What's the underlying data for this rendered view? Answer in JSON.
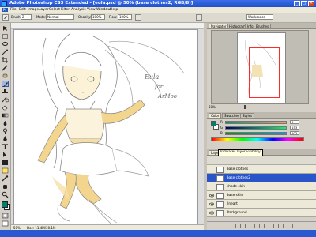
{
  "window": {
    "title": "Adobe Photoshop CS3 Extended - [eula.psd @ 50% (base clothes2, RGB/8)]"
  },
  "menu": [
    "File",
    "Edit",
    "Image",
    "Layer",
    "Select",
    "Filter",
    "Analysis",
    "View",
    "Window",
    "Help"
  ],
  "options": {
    "brush_label": "Brush:",
    "brush_size": "2",
    "mode_label": "Mode:",
    "mode_value": "Normal",
    "opacity_label": "Opacity:",
    "opacity_value": "100%",
    "flow_label": "Flow:",
    "flow_value": "100%",
    "workspace": "Workspace"
  },
  "canvas": {
    "signature_line1": "Eula",
    "signature_line2": "for",
    "signature_line3": "ArMoo"
  },
  "status": {
    "zoom": "50%",
    "doc_size": "Doc: 11.4M/30.1M"
  },
  "navigator": {
    "tabs": [
      "Navigator",
      "Histogram",
      "Info",
      "Brushes"
    ],
    "zoom": "50%"
  },
  "color_panel": {
    "tabs": [
      "Color",
      "Swatches",
      "Styles"
    ],
    "channels": [
      {
        "label": "R",
        "value": "0"
      },
      {
        "label": "G",
        "value": "153"
      },
      {
        "label": "B",
        "value": "102"
      }
    ],
    "colors": {
      "foreground": "#00806a",
      "background": "#ffffff",
      "accent": "#2a55c8"
    }
  },
  "layers_panel": {
    "tabs": [
      "Layers",
      "Channels",
      "Paths"
    ],
    "tooltip": "Indicates layer visibility",
    "layers": [
      {
        "name": "base clothes",
        "visible": false,
        "selected": false
      },
      {
        "name": "base clothes2",
        "visible": false,
        "selected": true
      },
      {
        "name": "shade skin",
        "visible": false,
        "selected": false
      },
      {
        "name": "base skin",
        "visible": true,
        "selected": false
      },
      {
        "name": "lineart",
        "visible": true,
        "selected": false
      },
      {
        "name": "Background",
        "visible": true,
        "selected": false
      }
    ]
  }
}
